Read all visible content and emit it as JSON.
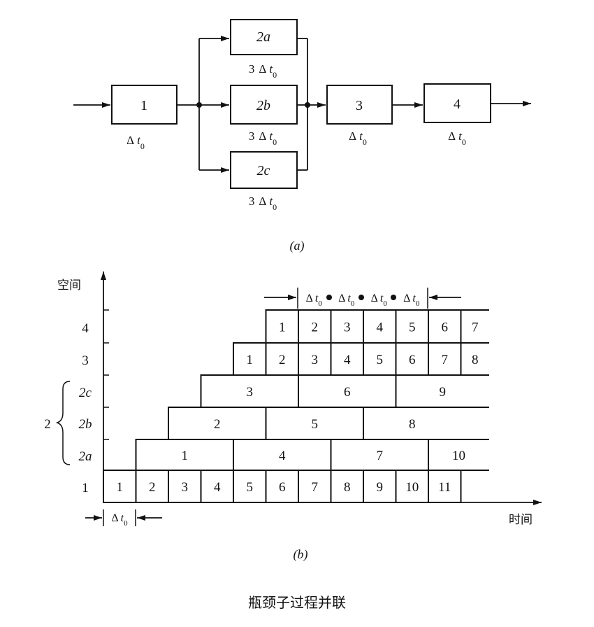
{
  "diagram_a": {
    "label": "(a)",
    "stages": [
      {
        "id": "1",
        "time_prefix": "",
        "time_symbol": "Δ",
        "time_var": "t",
        "time_sub": "0"
      },
      {
        "id": "2a",
        "time_prefix": "3",
        "time_symbol": "Δ",
        "time_var": "t",
        "time_sub": "0"
      },
      {
        "id": "2b",
        "time_prefix": "3",
        "time_symbol": "Δ",
        "time_var": "t",
        "time_sub": "0"
      },
      {
        "id": "2c",
        "time_prefix": "3",
        "time_symbol": "Δ",
        "time_var": "t",
        "time_sub": "0"
      },
      {
        "id": "3",
        "time_prefix": "",
        "time_symbol": "Δ",
        "time_var": "t",
        "time_sub": "0"
      },
      {
        "id": "4",
        "time_prefix": "",
        "time_symbol": "Δ",
        "time_var": "t",
        "time_sub": "0"
      }
    ]
  },
  "diagram_b": {
    "label": "(b)",
    "y_axis_label": "空间",
    "x_axis_label": "时间",
    "group_label": "2",
    "delta_label": {
      "symbol": "Δ",
      "var": "t",
      "sub": "0"
    },
    "rows": [
      {
        "name": "4",
        "cells": [
          "1",
          "2",
          "3",
          "4",
          "5",
          "6",
          "7"
        ]
      },
      {
        "name": "3",
        "cells": [
          "1",
          "2",
          "3",
          "4",
          "5",
          "6",
          "7",
          "8"
        ]
      },
      {
        "name": "2c",
        "cells": [
          "3",
          "6",
          "9"
        ]
      },
      {
        "name": "2b",
        "cells": [
          "2",
          "5",
          "8"
        ]
      },
      {
        "name": "2a",
        "cells": [
          "1",
          "4",
          "7",
          "10"
        ]
      },
      {
        "name": "1",
        "cells": [
          "1",
          "2",
          "3",
          "4",
          "5",
          "6",
          "7",
          "8",
          "9",
          "10",
          "11"
        ]
      }
    ]
  },
  "caption": "瓶颈子过程并联"
}
